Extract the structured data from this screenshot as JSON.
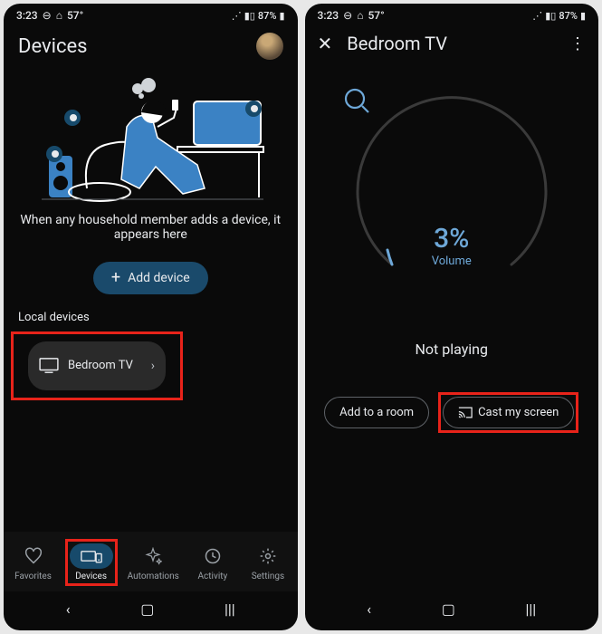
{
  "status": {
    "time": "3:23",
    "temp": "57°",
    "battery": "87%"
  },
  "screen1": {
    "title": "Devices",
    "empty_msg": "When any household member adds a device, it appears here",
    "add_label": "Add device",
    "section_label": "Local devices",
    "device_name": "Bedroom TV",
    "nav": {
      "favorites": "Favorites",
      "devices": "Devices",
      "automations": "Automations",
      "activity": "Activity",
      "settings": "Settings"
    }
  },
  "screen2": {
    "title": "Bedroom TV",
    "volume_pct": "3%",
    "volume_label": "Volume",
    "status": "Not playing",
    "add_room": "Add to a room",
    "cast": "Cast my screen"
  }
}
